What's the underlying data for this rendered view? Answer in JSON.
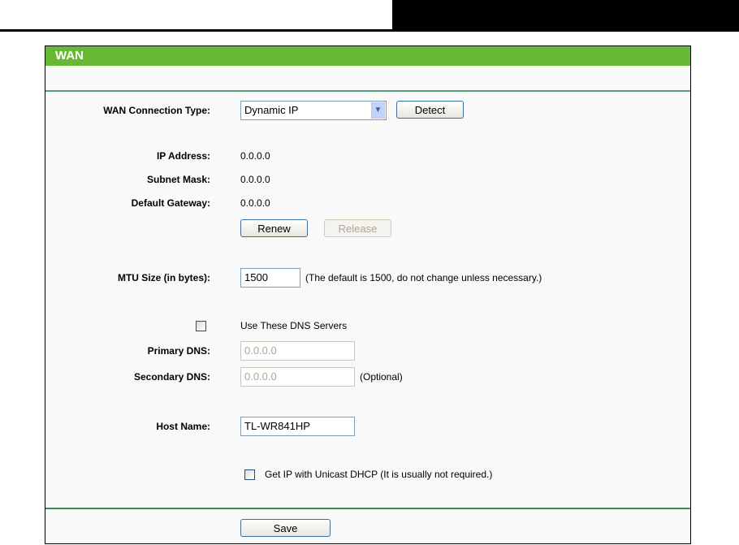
{
  "title": "WAN",
  "connection_type": {
    "label": "WAN Connection Type:",
    "value": "Dynamic IP",
    "detect": "Detect"
  },
  "ip_address": {
    "label": "IP Address:",
    "value": "0.0.0.0"
  },
  "subnet_mask": {
    "label": "Subnet Mask:",
    "value": "0.0.0.0"
  },
  "default_gateway": {
    "label": "Default Gateway:",
    "value": "0.0.0.0"
  },
  "renew": "Renew",
  "release": "Release",
  "mtu": {
    "label": "MTU Size (in bytes):",
    "value": "1500",
    "note": "(The default is 1500, do not change unless necessary.)"
  },
  "dns": {
    "checkbox_label": "Use These DNS Servers",
    "checked": false,
    "primary_label": "Primary DNS:",
    "primary_value": "0.0.0.0",
    "secondary_label": "Secondary DNS:",
    "secondary_value": "0.0.0.0",
    "optional": "(Optional)"
  },
  "host_name": {
    "label": "Host Name:",
    "value": "TL-WR841HP"
  },
  "unicast": {
    "label": "Get IP with Unicast DHCP (It is usually not required.)",
    "checked": false
  },
  "save": "Save"
}
